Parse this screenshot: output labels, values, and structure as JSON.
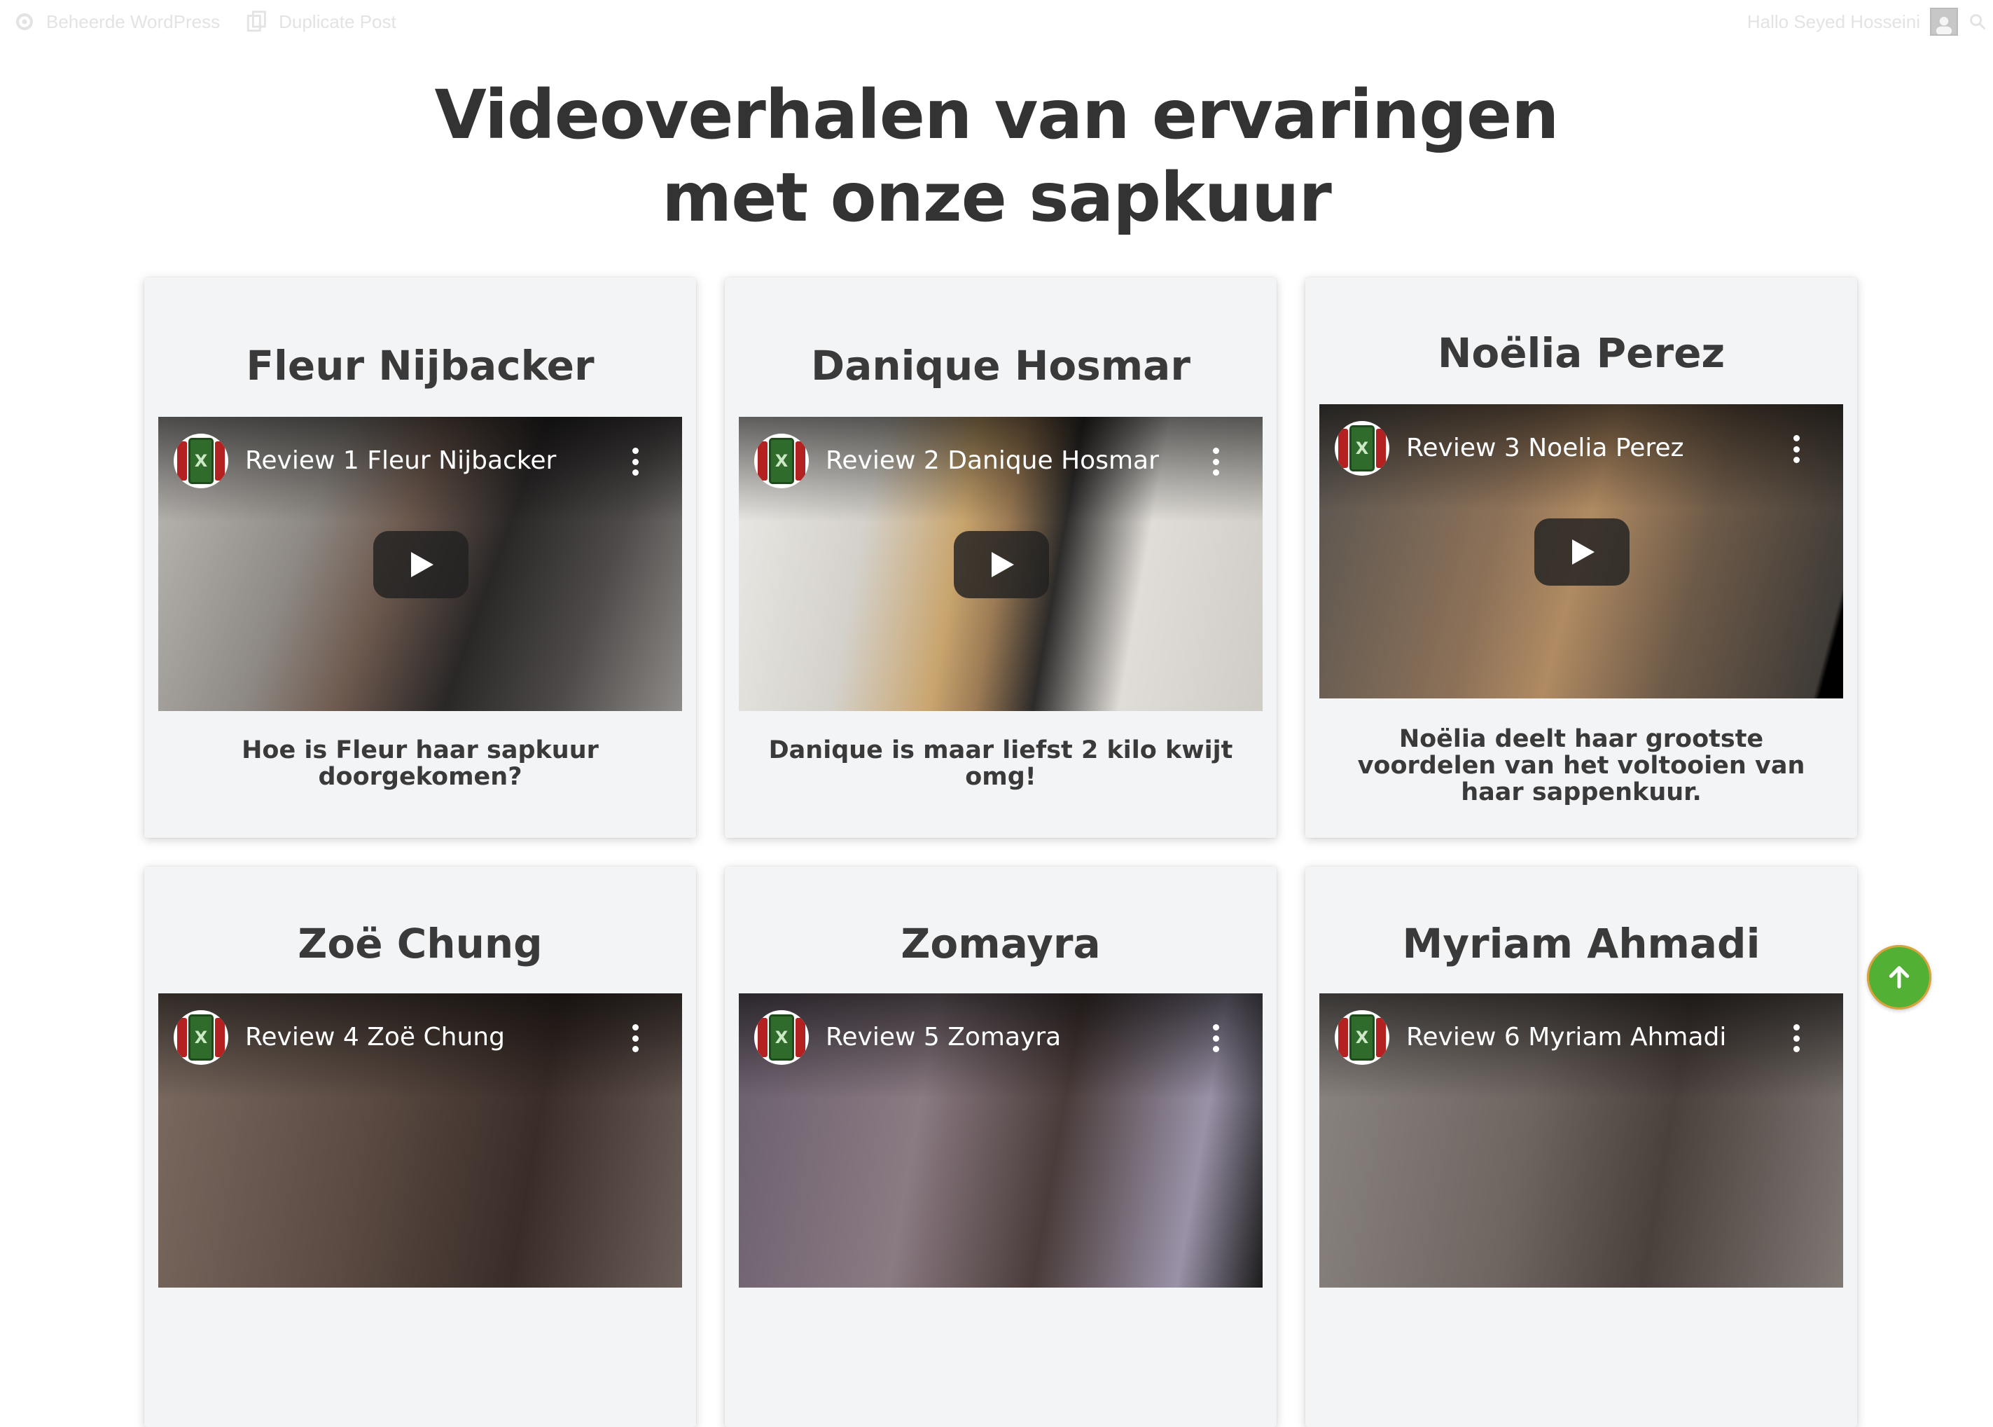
{
  "adminbar": {
    "manage_label": "Beheerde WordPress",
    "duplicate_label": "Duplicate Post",
    "greeting": "Hallo Seyed Hosseini"
  },
  "page": {
    "title_line1": "Videoverhalen van ervaringen",
    "title_line2": "met onze sapkuur"
  },
  "cards": [
    {
      "name": "Fleur Nijbacker",
      "video_title": "Review 1 Fleur Nijbacker",
      "description": "Hoe is Fleur haar sapkuur doorgekomen?"
    },
    {
      "name": "Danique Hosmar",
      "video_title": "Review 2 Danique Hosmar",
      "description": "Danique is maar liefst 2 kilo kwijt omg!"
    },
    {
      "name": "Noëlia Perez",
      "video_title": "Review 3 Noelia Perez",
      "description": "Noëlia deelt haar grootste voordelen van het voltooien van haar sappenkuur."
    },
    {
      "name": "Zoë Chung",
      "video_title": "Review 4 Zoë Chung",
      "description": ""
    },
    {
      "name": "Zomayra",
      "video_title": "Review 5 Zomayra",
      "description": ""
    },
    {
      "name": "Myriam Ahmadi",
      "video_title": "Review 6 Myriam Ahmadi",
      "description": ""
    }
  ],
  "colors": {
    "card_bg": "#f3f4f6",
    "heading": "#333333",
    "accent_green": "#52b034"
  },
  "icons": {
    "manage": "gear-icon",
    "duplicate": "copy-icon",
    "avatar": "user-avatar-icon",
    "search": "search-icon",
    "play": "play-icon",
    "menu": "more-vertical-icon",
    "to_top": "arrow-up-icon"
  }
}
